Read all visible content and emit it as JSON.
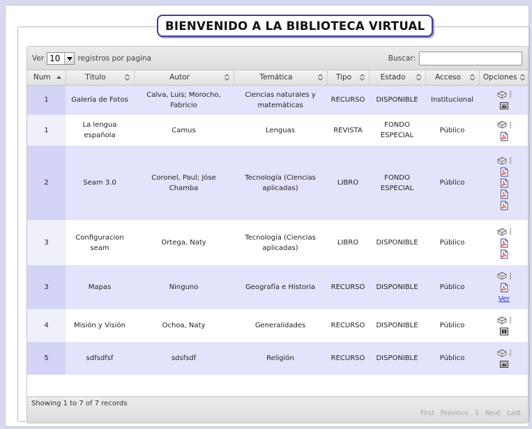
{
  "title": "BIENVENIDO A LA BIBLIOTECA VIRTUAL",
  "length": {
    "prefix": "Ver",
    "value": "10",
    "suffix": "registros por pagina"
  },
  "search": {
    "label": "Buscar:",
    "value": ""
  },
  "columns": [
    "Num",
    "Título",
    "Autor",
    "Temática",
    "Tipo",
    "Estado",
    "Acceso",
    "Opciones"
  ],
  "rows": [
    {
      "num": "1",
      "titulo": "Galería de Fotos",
      "autor": "Calva, Luis; Morocho, Fabricio",
      "tematica": "Ciencias naturales y matemáticas",
      "tipo": "RECURSO",
      "estado": "DISPONIBLE",
      "acceso": "Institucional",
      "icons": [
        "image-icon"
      ]
    },
    {
      "num": "1",
      "titulo": "La lengua española",
      "autor": "Camus",
      "tematica": "Lenguas",
      "tipo": "REVISTA",
      "estado": "FONDO ESPECIAL",
      "acceso": "Público",
      "icons": [
        "pdf-icon"
      ]
    },
    {
      "num": "2",
      "titulo": "Seam 3.0",
      "autor": "Coronel, Paul; Jóse Chamba",
      "tematica": "Tecnología (Ciencias aplicadas)",
      "tipo": "LIBRO",
      "estado": "FONDO ESPECIAL",
      "acceso": "Público",
      "icons": [
        "pdf-icon",
        "pdf-icon",
        "pdf-icon",
        "pdf-icon"
      ]
    },
    {
      "num": "3",
      "titulo": "Configuracion seam",
      "autor": "Ortega, Naty",
      "tematica": "Tecnología (Ciencias aplicadas)",
      "tipo": "LIBRO",
      "estado": "DISPONIBLE",
      "acceso": "Público",
      "icons": [
        "pdf-icon",
        "pdf-icon"
      ]
    },
    {
      "num": "3",
      "titulo": "Mapas",
      "autor": "Ninguno",
      "tematica": "Geografía e Historia",
      "tipo": "RECURSO",
      "estado": "DISPONIBLE",
      "acceso": "Público",
      "icons": [
        "pdf-icon"
      ],
      "link": "Ver"
    },
    {
      "num": "4",
      "titulo": "Misión y Visión",
      "autor": "Ochoa, Naty",
      "tematica": "Generalidades",
      "tipo": "RECURSO",
      "estado": "DISPONIBLE",
      "acceso": "Público",
      "icons": [
        "video-icon"
      ]
    },
    {
      "num": "5",
      "titulo": "sdfsdfsf",
      "autor": "sdsfsdf",
      "tematica": "Religión",
      "tipo": "RECURSO",
      "estado": "DISPONIBLE",
      "acceso": "Público",
      "icons": [
        "image-icon"
      ]
    }
  ],
  "footer": {
    "info": "Showing 1 to 7 of 7 records",
    "pagination": [
      "First",
      "Previous",
      "1",
      "Next",
      "Last"
    ]
  }
}
